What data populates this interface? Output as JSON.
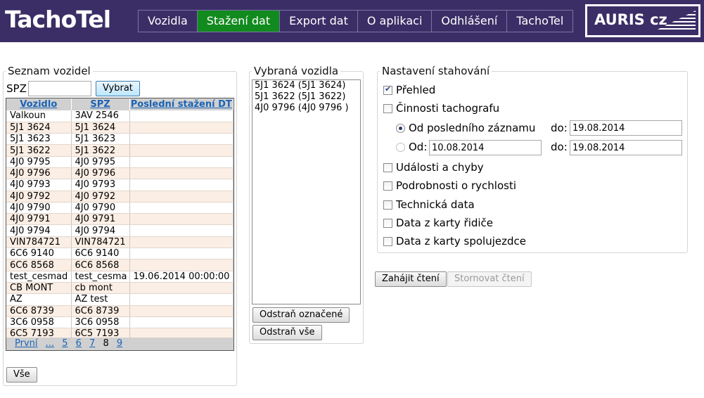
{
  "app": {
    "logo": "TachoTel"
  },
  "nav": {
    "items": [
      "Vozidla",
      "Stažení dat",
      "Export dat",
      "O aplikaci",
      "Odhlášení",
      "TachoTel"
    ],
    "active": "Stažení dat"
  },
  "brand": {
    "text": "AURIS cz"
  },
  "vehicle_list": {
    "legend": "Seznam vozidel",
    "spz_label": "SPZ",
    "spz_value": "",
    "select_button": "Vybrat",
    "columns": [
      "Vozidlo",
      "SPZ",
      "Poslední stažení DT"
    ],
    "rows": [
      [
        "Valkoun",
        "3AV 2546",
        ""
      ],
      [
        "5J1 3624",
        "5J1 3624",
        ""
      ],
      [
        "5J1 3623",
        "5J1 3623",
        ""
      ],
      [
        "5J1 3622",
        "5J1 3622",
        ""
      ],
      [
        "4J0 9795",
        "4J0 9795",
        ""
      ],
      [
        "4J0 9796",
        "4J0 9796",
        ""
      ],
      [
        "4J0 9793",
        "4J0 9793",
        ""
      ],
      [
        "4J0 9792",
        "4J0 9792",
        ""
      ],
      [
        "4J0 9790",
        "4J0 9790",
        ""
      ],
      [
        "4J0 9791",
        "4J0 9791",
        ""
      ],
      [
        "4J0 9794",
        "4J0 9794",
        ""
      ],
      [
        "VIN784721",
        "VIN784721",
        ""
      ],
      [
        "6C6 9140",
        "6C6 9140",
        ""
      ],
      [
        "6C6 8568",
        "6C6 8568",
        ""
      ],
      [
        "test_cesmad",
        "test_cesma",
        "19.06.2014 00:00:00"
      ],
      [
        "CB MONT",
        "cb mont",
        ""
      ],
      [
        "AZ",
        "AZ test",
        ""
      ],
      [
        "6C6 8739",
        "6C6 8739",
        ""
      ],
      [
        "3C6 0958",
        "3C6 0958",
        ""
      ],
      [
        "6C5 7193",
        "6C5 7193",
        ""
      ]
    ],
    "pager": [
      "První",
      "...",
      "5",
      "6",
      "7",
      "8",
      "9"
    ],
    "current_page": "8",
    "all_button": "Vše"
  },
  "selected": {
    "legend": "Vybraná vozidla",
    "items": [
      "5J1 3624 (5J1 3624)",
      "5J1 3622 (5J1 3622)",
      "4J0 9796 (4J0 9796 )"
    ],
    "remove_selected": "Odstraň označené",
    "remove_all": "Odstraň vše"
  },
  "settings": {
    "legend": "Nastavení stahování",
    "overview": "Přehled",
    "activities": "Činnosti tachografu",
    "from_last": "Od posledního záznamu",
    "from": "Od:",
    "to_label": "do:",
    "date_to_1": "19.08.2014",
    "date_from": "10.08.2014",
    "date_to_2": "19.08.2014",
    "events": "Události a chyby",
    "speed": "Podrobnosti o rychlosti",
    "technical": "Technická data",
    "driver_card": "Data z karty řidiče",
    "codriver_card": "Data z karty spolujezdce",
    "start_button": "Zahájit čtení",
    "cancel_button": "Stornovat čtení"
  }
}
